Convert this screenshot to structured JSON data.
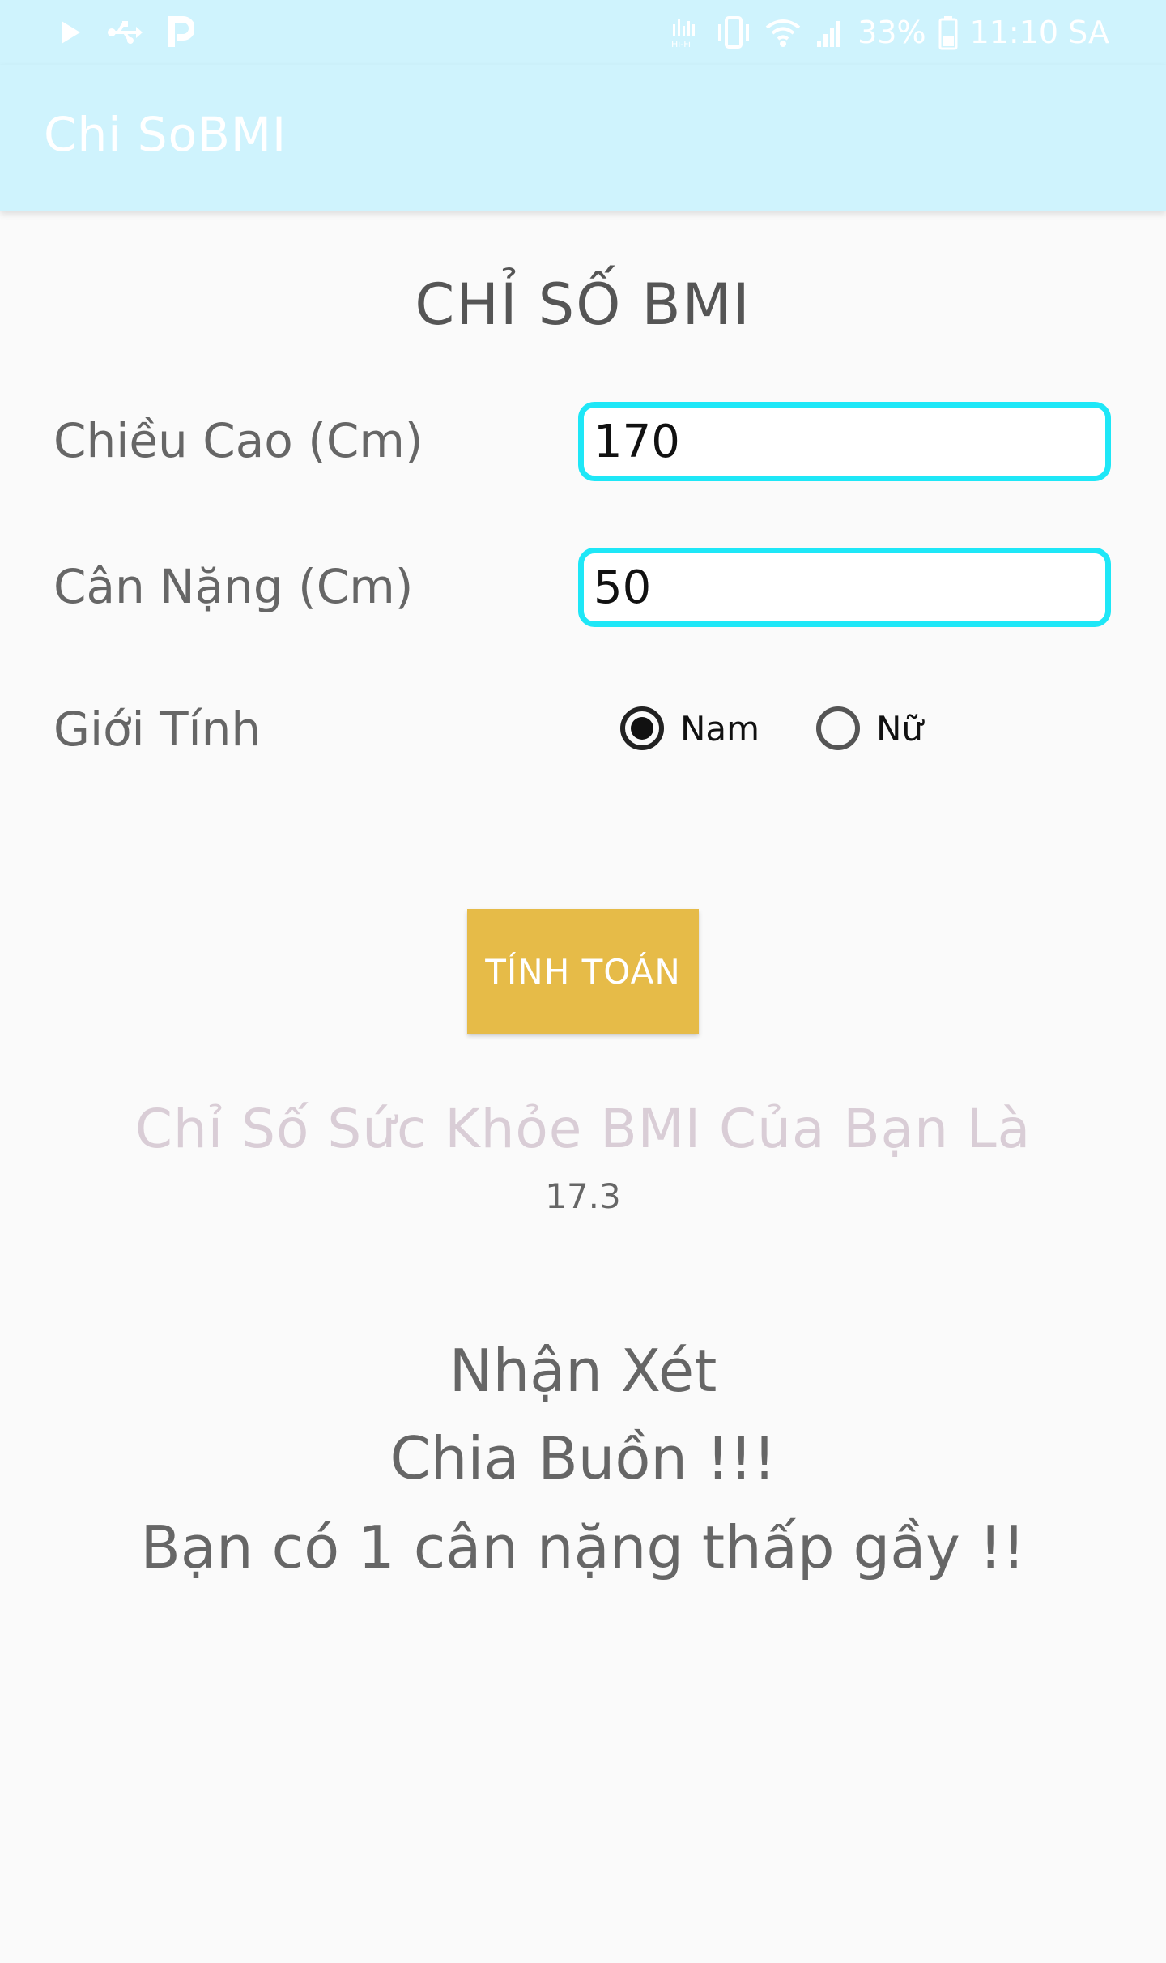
{
  "status_bar": {
    "battery": "33%",
    "time": "11:10 SA",
    "icons_left": [
      "play-icon",
      "usb-icon",
      "p-icon"
    ],
    "icons_right": [
      "hifi-icon",
      "vibrate-icon",
      "wifi-icon",
      "signal-icon",
      "battery-icon"
    ]
  },
  "app_bar": {
    "title": "Chi SoBMI"
  },
  "heading": "CHỈ SỐ BMI",
  "form": {
    "height_label": "Chiều Cao (Cm)",
    "height_value": "170",
    "weight_label": "Cân Nặng (Cm)",
    "weight_value": "50",
    "gender_label": "Giới Tính",
    "gender_options": [
      {
        "label": "Nam",
        "selected": true
      },
      {
        "label": "Nữ",
        "selected": false
      }
    ]
  },
  "calculate_button": "TÍNH TOÁN",
  "result": {
    "title": "Chỉ Số Sức Khỏe BMI Của Bạn Là",
    "value": "17.3"
  },
  "comment": {
    "title": "Nhận Xét",
    "line1": "Chia Buồn !!!",
    "line2": "Bạn có 1 cân nặng thấp gầy !!"
  },
  "colors": {
    "app_bar": "#cff3fd",
    "input_border": "#1ee7f7",
    "button": "#e6bb48",
    "background": "#fafafa"
  }
}
